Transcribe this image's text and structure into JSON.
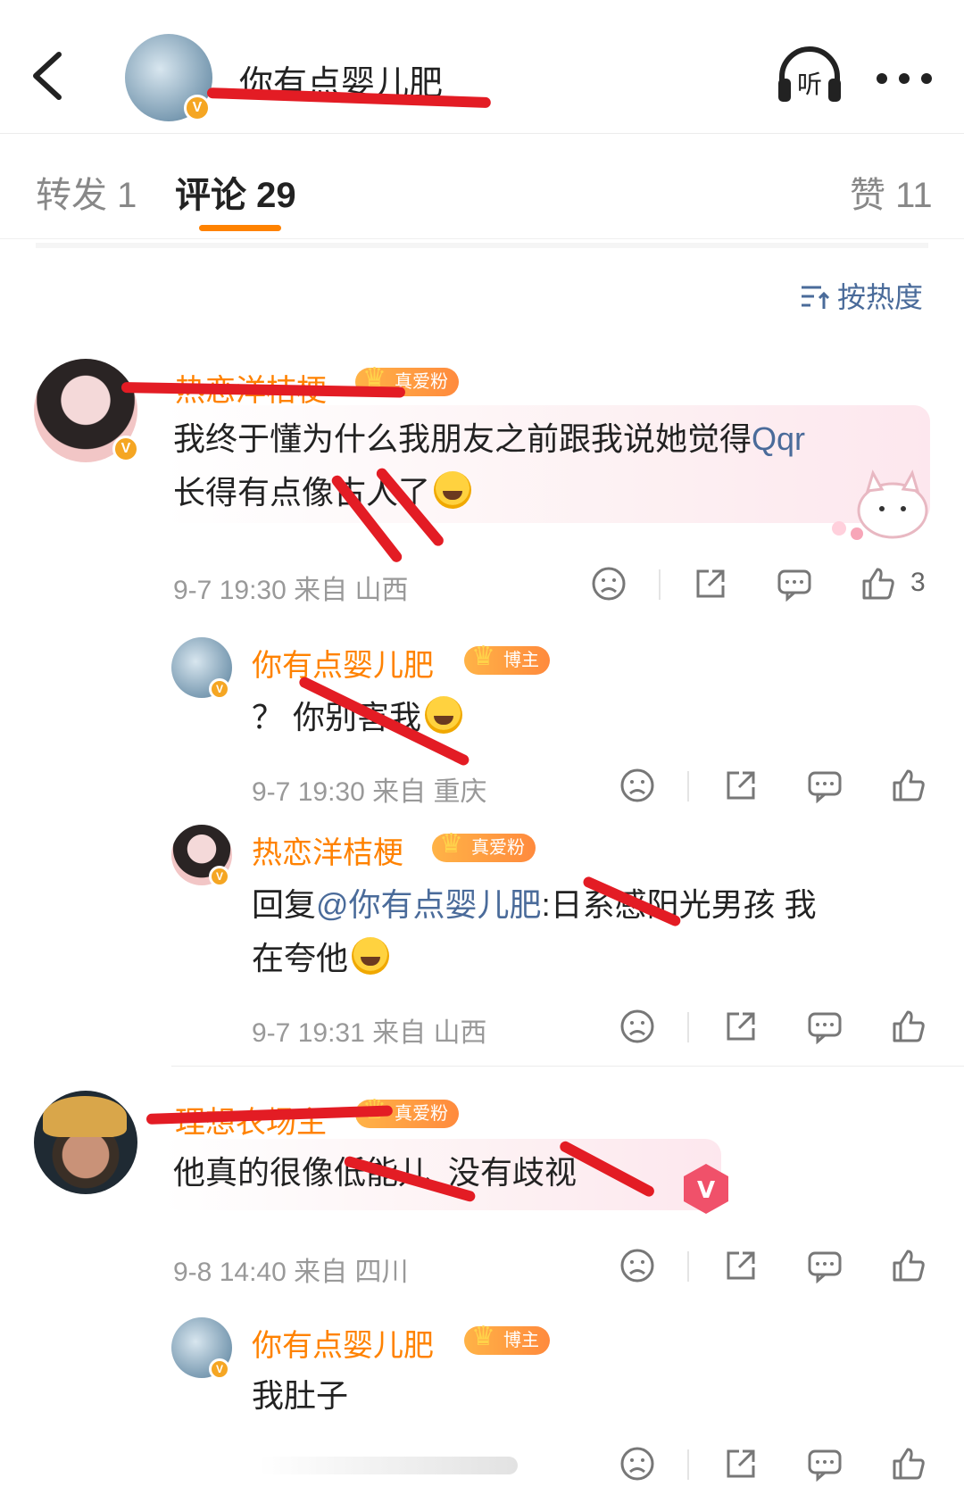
{
  "header": {
    "title": "你有点婴儿肥",
    "avatar_badge": "V",
    "listen_label": "听",
    "back_icon": "chevron-left-icon",
    "more_icon": "more-horizontal-icon"
  },
  "tabs": [
    {
      "label": "转发 1"
    },
    {
      "label": "评论 29"
    },
    {
      "label": "赞 11"
    }
  ],
  "sort_label": "按热度",
  "comments": [
    {
      "author": "热恋洋桔梗",
      "badge": "真爱粉",
      "text1": "我终于懂为什么我朋友之前跟我说她觉得",
      "link": "Qqr",
      "text2": "长得有点像",
      "text2b": "古人了",
      "time": "9-7 19:30",
      "from": "来自 山西",
      "likes": "3"
    },
    {
      "author": "你有点婴儿肥",
      "badge": "博主",
      "text": "？ 你别害我",
      "time": "9-7 19:30",
      "from": "来自 重庆"
    },
    {
      "author": "热恋洋桔梗",
      "badge": "真爱粉",
      "reply_prefix": "回复",
      "mention": "@你有点婴儿肥",
      "text1": ":日系感阳光男孩 我",
      "text2": "在夸他",
      "time": "9-7 19:31",
      "from": "来自 山西"
    },
    {
      "author": "理想农场主",
      "badge": "真爱粉",
      "text": "他真的很像低能儿  没有歧视",
      "time": "9-8 14:40",
      "from": "来自 四川"
    },
    {
      "author": "你有点婴儿肥",
      "badge": "博主",
      "text": "我肚子"
    }
  ],
  "colors": {
    "accent": "#ff8200",
    "link": "#4a6b9a",
    "redaction": "#e31c24"
  }
}
